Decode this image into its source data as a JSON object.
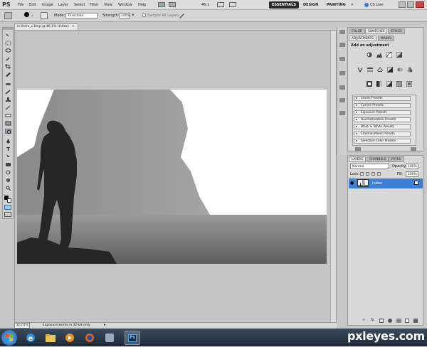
{
  "app": {
    "logo": "PS"
  },
  "menu": [
    "File",
    "Edit",
    "Image",
    "Layer",
    "Select",
    "Filter",
    "View",
    "Window",
    "Help"
  ],
  "menubar_zoom": "46.1",
  "workspaces": [
    "ESSENTIALS",
    "DESIGN",
    "PAINTING"
  ],
  "cs_live": "CS Live",
  "options": {
    "mode_label": "Mode:",
    "mode_value": "Threshold",
    "strength_label": "Strength:",
    "strength_value": "100%",
    "sample_all_layers": "Sample All Layers"
  },
  "document": {
    "tab_title": "in there_c.bmp @ 46.1% (Index)",
    "zoom": "46.07%",
    "status": "Exposure works in 32-bit only"
  },
  "adjustments": {
    "tabs": [
      "ADJUSTMENTS",
      "MASKS"
    ],
    "top_tabs": [
      "COLOR",
      "SWATCHES",
      "STYLES"
    ],
    "heading": "Add an adjustment",
    "presets": [
      "Levels Presets",
      "Curves Presets",
      "Exposure Presets",
      "Hue/Saturation Presets",
      "Black & White Presets",
      "Channel Mixer Presets",
      "Selective Color Presets"
    ]
  },
  "layers": {
    "tabs": [
      "LAYERS",
      "CHANNELS",
      "PATHS"
    ],
    "blend_mode": "Normal",
    "opacity_label": "Opacity:",
    "opacity_value": "100%",
    "lock_label": "Lock:",
    "fill_label": "Fill:",
    "fill_value": "100%",
    "layer_name": "Index"
  },
  "watermark": "pxleyes.com",
  "colors": {
    "essentials_bg": "#2a2a2a",
    "layer_selected": "#3d7fd6",
    "taskbar": "#2a3646",
    "canvas_white": "#ffffff",
    "silhouette": "#262626"
  }
}
